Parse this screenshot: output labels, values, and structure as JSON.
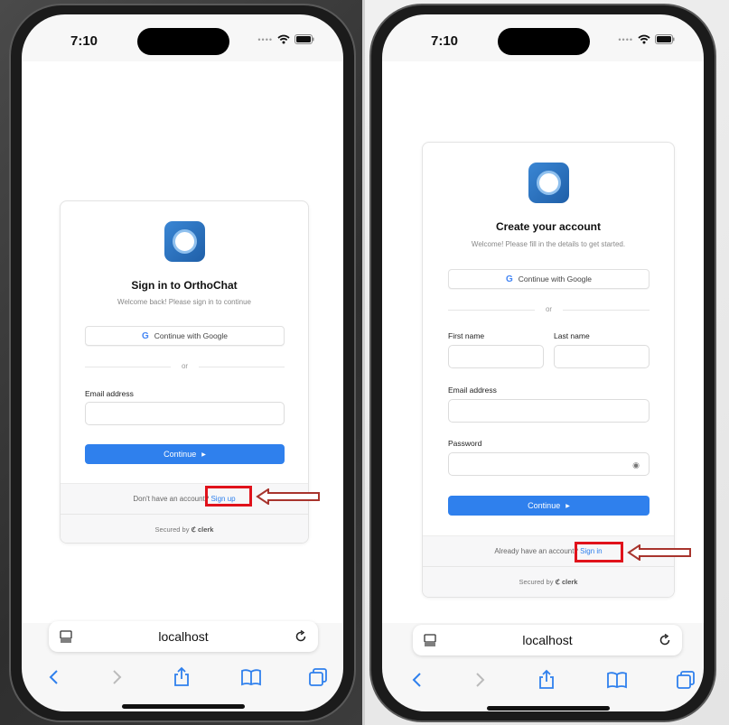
{
  "phones": [
    {
      "status": {
        "time": "7:10"
      },
      "card": {
        "title": "Sign in to OrthoChat",
        "subtitle": "Welcome back! Please sign in to continue",
        "google_label": "Continue with Google",
        "or_label": "or",
        "email_label": "Email address",
        "email_value": "",
        "continue_label": "Continue",
        "footer_prefix": "Don't have an account?",
        "footer_link": "Sign up",
        "secured_label": "Secured by",
        "brand": "clerk"
      },
      "browser": {
        "address": "localhost"
      }
    },
    {
      "status": {
        "time": "7:10"
      },
      "card": {
        "title": "Create your account",
        "subtitle": "Welcome! Please fill in the details to get started.",
        "google_label": "Continue with Google",
        "or_label": "or",
        "first_name_label": "First name",
        "last_name_label": "Last name",
        "email_label": "Email address",
        "password_label": "Password",
        "continue_label": "Continue",
        "footer_prefix": "Already have an account?",
        "footer_link": "Sign in",
        "secured_label": "Secured by",
        "brand": "clerk"
      },
      "browser": {
        "address": "localhost"
      }
    }
  ],
  "colors": {
    "accent": "#2f80ed",
    "highlight": "#e0121b",
    "logo": "#1f5fa8"
  },
  "icons": [
    "back-icon",
    "forward-icon",
    "share-icon",
    "bookmarks-icon",
    "tabs-icon",
    "reader-icon",
    "reload-icon",
    "wifi-icon",
    "battery-icon",
    "google-icon",
    "eye-icon"
  ]
}
